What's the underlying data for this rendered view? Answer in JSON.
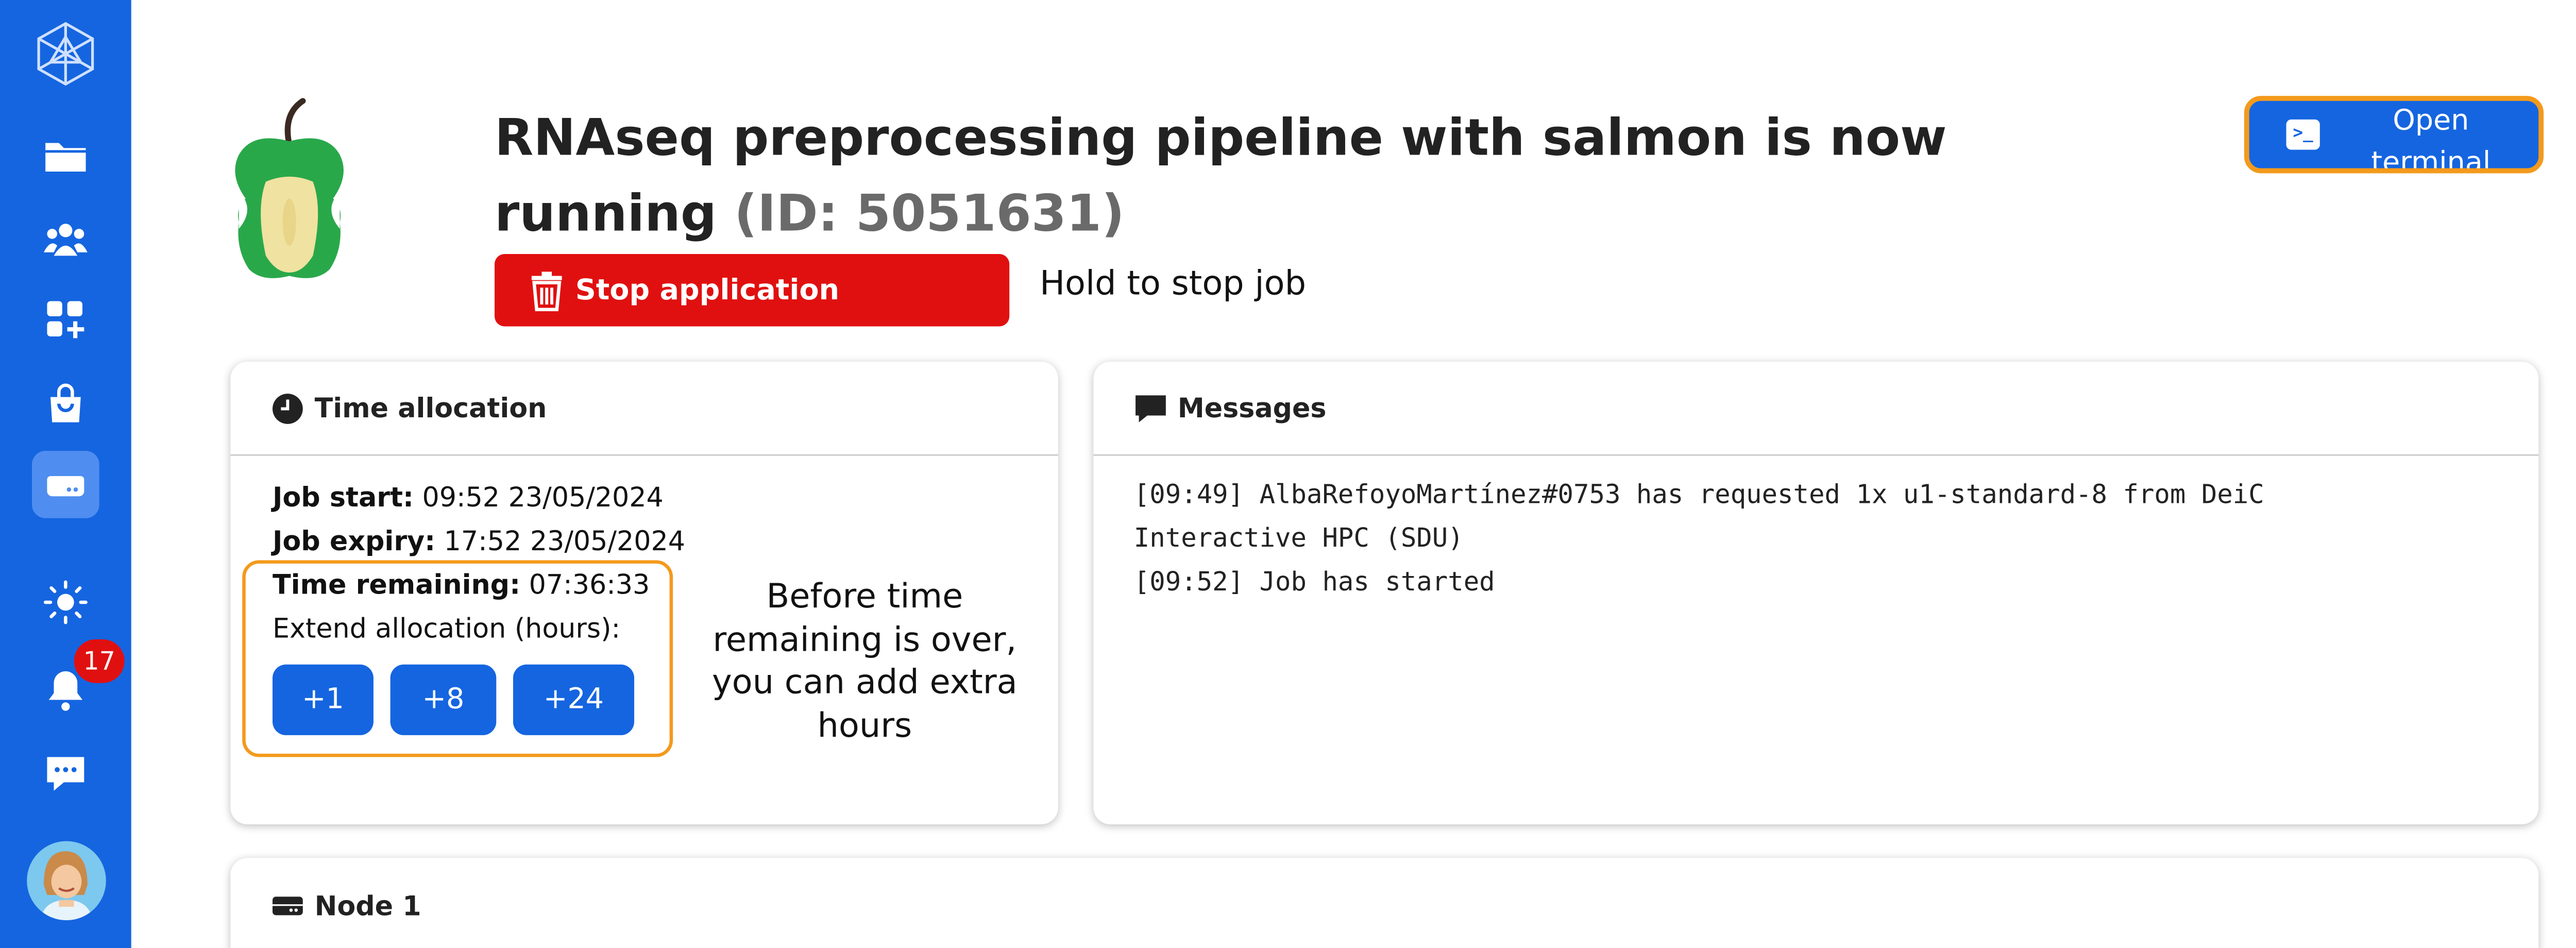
{
  "sidebar": {
    "notification_count": "17",
    "items": [
      {
        "name": "logo-icon"
      },
      {
        "name": "files-icon"
      },
      {
        "name": "users-icon"
      },
      {
        "name": "apps-icon"
      },
      {
        "name": "shop-icon"
      },
      {
        "name": "resources-icon"
      },
      {
        "name": "theme-icon"
      },
      {
        "name": "notifications-icon"
      },
      {
        "name": "chat-icon"
      }
    ]
  },
  "header": {
    "title": "RNAseq preprocessing pipeline with salmon is now running",
    "job_id_label": "(ID: 5051631)",
    "stop_label": "Stop application",
    "hold_hint": "Hold to stop job",
    "terminal_label": "Open terminal"
  },
  "time_allocation": {
    "title": "Time allocation",
    "job_start_label": "Job start:",
    "job_start_value": "09:52 23/05/2024",
    "job_expiry_label": "Job expiry:",
    "job_expiry_value": "17:52 23/05/2024",
    "remaining_label": "Time remaining:",
    "remaining_value": "07:36:33",
    "extend_label": "Extend allocation (hours):",
    "extend_options": [
      "+1",
      "+8",
      "+24"
    ],
    "annotation": "Before time remaining is over, you can add extra hours"
  },
  "messages": {
    "title": "Messages",
    "lines": [
      "[09:49] AlbaRefoyoMartínez#0753 has requested 1x u1-standard-8 from DeiC",
      "Interactive HPC (SDU)",
      "[09:52] Job has started"
    ]
  },
  "node": {
    "title": "Node 1"
  },
  "colors": {
    "sidebar": "#1565e0",
    "stop": "#e11010",
    "highlight": "#f39a1c",
    "badge": "#e01010"
  }
}
